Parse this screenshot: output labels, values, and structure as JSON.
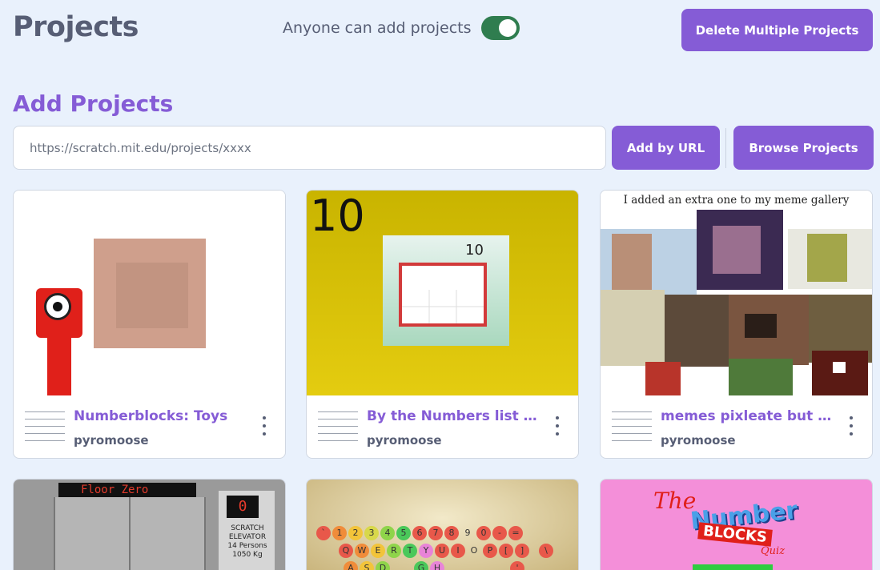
{
  "header": {
    "title": "Projects",
    "toggle_label": "Anyone can add projects",
    "toggle_on": true,
    "delete_button": "Delete Multiple Projects"
  },
  "add_section": {
    "title": "Add Projects",
    "url_placeholder": "https://scratch.mit.edu/projects/xxxx",
    "url_value": "",
    "add_url_button": "Add by URL",
    "browse_button": "Browse Projects"
  },
  "projects": [
    {
      "title": "Numberblocks: Toys",
      "author": "pyromoose"
    },
    {
      "title": "By the Numbers list (...",
      "author": "pyromoose",
      "thumb_text": "10"
    },
    {
      "title": "memes pixleate but i ...",
      "author": "pyromoose",
      "thumb_caption": "I added an extra one to my meme gallery"
    },
    {
      "thumb_text": "Floor Zero",
      "thumb_label": "SCRATCH ELEVATOR 14 Persons 1050 Kg"
    },
    {
      "thumb_text": "QWERTYUIOP"
    },
    {
      "thumb_text": "The Number Blocks Quiz"
    }
  ],
  "colors": {
    "accent": "#855cd6",
    "text": "#575e75",
    "background": "#e9f1fc",
    "toggle_on": "#2f7d4f"
  }
}
